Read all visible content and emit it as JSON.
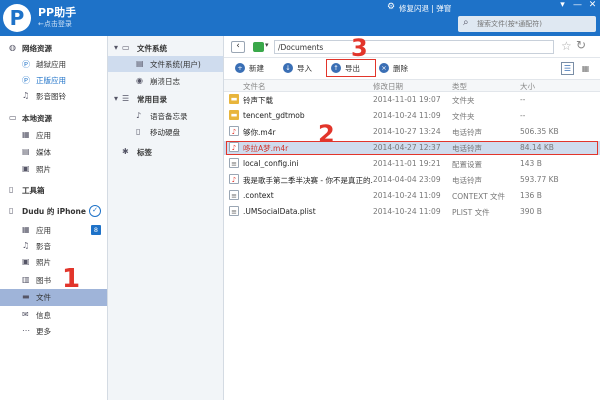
{
  "app": {
    "name": "PP助手",
    "login_link": "←点击登录",
    "logo_letter": "P",
    "repair_text": "修复闪退 | 弹窗",
    "search_placeholder": "搜索文件(按*通配符)",
    "window_buttons": [
      "▾",
      "—",
      "✕"
    ]
  },
  "sidebar": {
    "sections": [
      {
        "title": "网络资源",
        "icon": "globe-icon",
        "items": [
          {
            "label": "越狱应用",
            "icon": "app-store-icon"
          },
          {
            "label": "正版应用",
            "icon": "app-store-icon",
            "highlight": true
          },
          {
            "label": "影音图铃",
            "icon": "music-icon"
          }
        ]
      },
      {
        "title": "本地资源",
        "icon": "monitor-icon",
        "items": [
          {
            "label": "应用",
            "icon": "grid-icon"
          },
          {
            "label": "媒体",
            "icon": "media-icon"
          },
          {
            "label": "照片",
            "icon": "photo-icon"
          }
        ]
      },
      {
        "title": "工具箱",
        "icon": "toolbox-icon",
        "items": []
      },
      {
        "title": "Dudu 的 iPhone",
        "icon": "phone-icon",
        "items": [
          {
            "label": "应用",
            "icon": "grid-icon",
            "badge": "8"
          },
          {
            "label": "影音",
            "icon": "music-icon"
          },
          {
            "label": "照片",
            "icon": "photo-icon"
          },
          {
            "label": "图书",
            "icon": "book-icon"
          },
          {
            "label": "文件",
            "icon": "folder-icon",
            "active": true
          },
          {
            "label": "信息",
            "icon": "message-icon"
          },
          {
            "label": "更多",
            "icon": "more-icon"
          }
        ]
      }
    ]
  },
  "tree": {
    "filesystem": "文件系统",
    "filesystem_user": "文件系统(用户)",
    "crash_log": "崩溃日志",
    "common_dirs": "常用目录",
    "voice_memo": "语音备忘录",
    "mobile_disk": "移动硬盘",
    "bookmarks": "标签"
  },
  "main": {
    "path": "/Documents",
    "toolbar": {
      "new": "新建",
      "import": "导入",
      "export": "导出",
      "delete": "删除"
    },
    "columns": {
      "name": "文件名",
      "modified": "修改日期",
      "type": "类型",
      "size": "大小"
    },
    "files": [
      {
        "name": "铃声下载",
        "date": "2014-11-01 19:07",
        "type": "文件夹",
        "size": "--",
        "kind": "folder"
      },
      {
        "name": "tencent_gdtmob",
        "date": "2014-10-24 11:09",
        "type": "文件夹",
        "size": "--",
        "kind": "folder"
      },
      {
        "name": "够你.m4r",
        "date": "2014-10-27 13:24",
        "type": "电话铃声",
        "size": "506.35 KB",
        "kind": "ring"
      },
      {
        "name": "哆拉A梦.m4r",
        "date": "2014-04-27 12:37",
        "type": "电话铃声",
        "size": "84.14 KB",
        "kind": "ring"
      },
      {
        "name": "local_config.ini",
        "date": "2014-11-01 19:21",
        "type": "配置设置",
        "size": "143 B",
        "kind": "doc"
      },
      {
        "name": "我是歌手第二季半决赛 - 你不是真正的...",
        "date": "2014-04-04 23:09",
        "type": "电话铃声",
        "size": "593.77 KB",
        "kind": "ring"
      },
      {
        "name": ".context",
        "date": "2014-10-24 11:09",
        "type": "CONTEXT 文件",
        "size": "136 B",
        "kind": "doc"
      },
      {
        "name": ".UMSocialData.plist",
        "date": "2014-10-24 11:09",
        "type": "PLIST 文件",
        "size": "390 B",
        "kind": "doc"
      }
    ]
  },
  "annotations": [
    "1",
    "2",
    "3"
  ],
  "colors": {
    "accent": "#1e72c8",
    "annotation": "#e2352b",
    "active_nav": "#9fb4d9"
  }
}
